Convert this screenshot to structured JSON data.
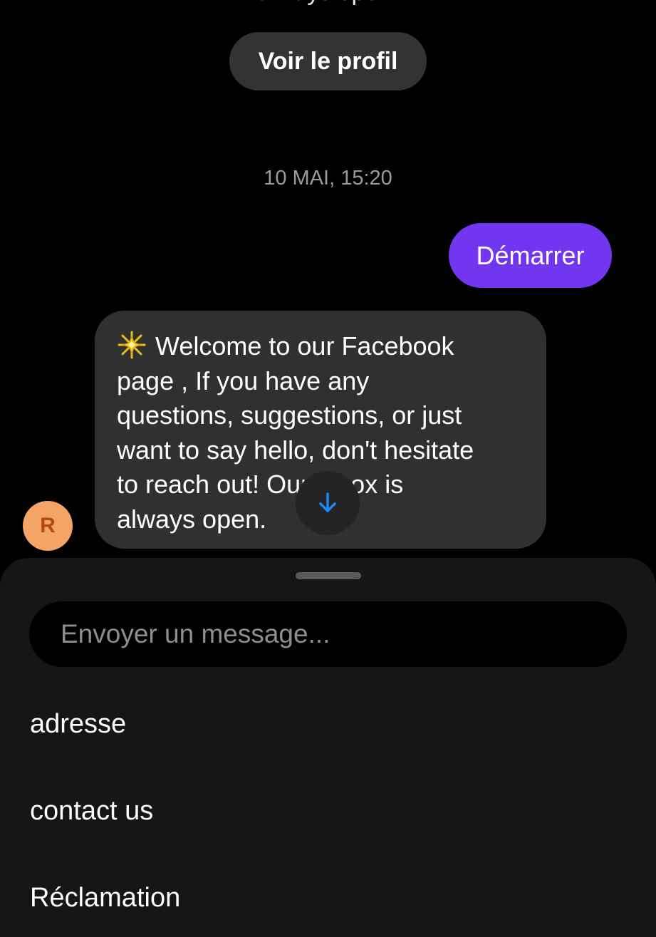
{
  "conversation": {
    "clipped_previous_text": "always open.",
    "profile_button_label": "Voir le profil",
    "timestamp": "10 MAI, 15:20",
    "sent_message": "Démarrer",
    "received_message": "Welcome to our Facebook\npage , If you have any\nquestions, suggestions, or just\nwant to say hello, don't hesitate\nto reach out! Our inbox is\nalways open.",
    "received_message_icon": "sparkle-icon",
    "avatar_initial": "R",
    "scroll_button_icon": "arrow-down-icon"
  },
  "composer": {
    "placeholder": "Envoyer un message...",
    "value": ""
  },
  "quick_replies": [
    {
      "label": "adresse"
    },
    {
      "label": "contact us"
    },
    {
      "label": "Réclamation"
    }
  ],
  "colors": {
    "background": "#000000",
    "sent_bubble": "#7236f0",
    "received_bubble": "#303030",
    "sheet": "#161616",
    "avatar": "#f5a468",
    "accent_arrow": "#1e88f5"
  }
}
